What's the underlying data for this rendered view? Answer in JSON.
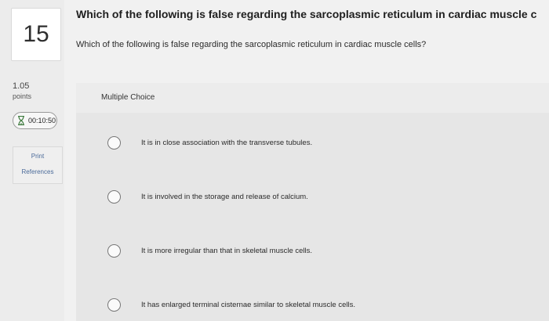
{
  "question": {
    "number": "15",
    "points_value": "1.05",
    "points_label": "points",
    "title": "Which of the following is false regarding the sarcoplasmic reticulum in cardiac muscle c",
    "prompt": "Which of the following is false regarding the sarcoplasmic reticulum in cardiac muscle cells?"
  },
  "timer": {
    "icon": "hourglass-icon",
    "value": "00:10:50"
  },
  "side_links": {
    "print": "Print",
    "references": "References"
  },
  "answer_area": {
    "label": "Multiple Choice",
    "options": [
      "It is in close association with the transverse tubules.",
      "It is involved in the storage and release of calcium.",
      "It is more irregular than that in skeletal muscle cells.",
      "It has enlarged terminal cisternae similar to skeletal muscle cells."
    ]
  }
}
